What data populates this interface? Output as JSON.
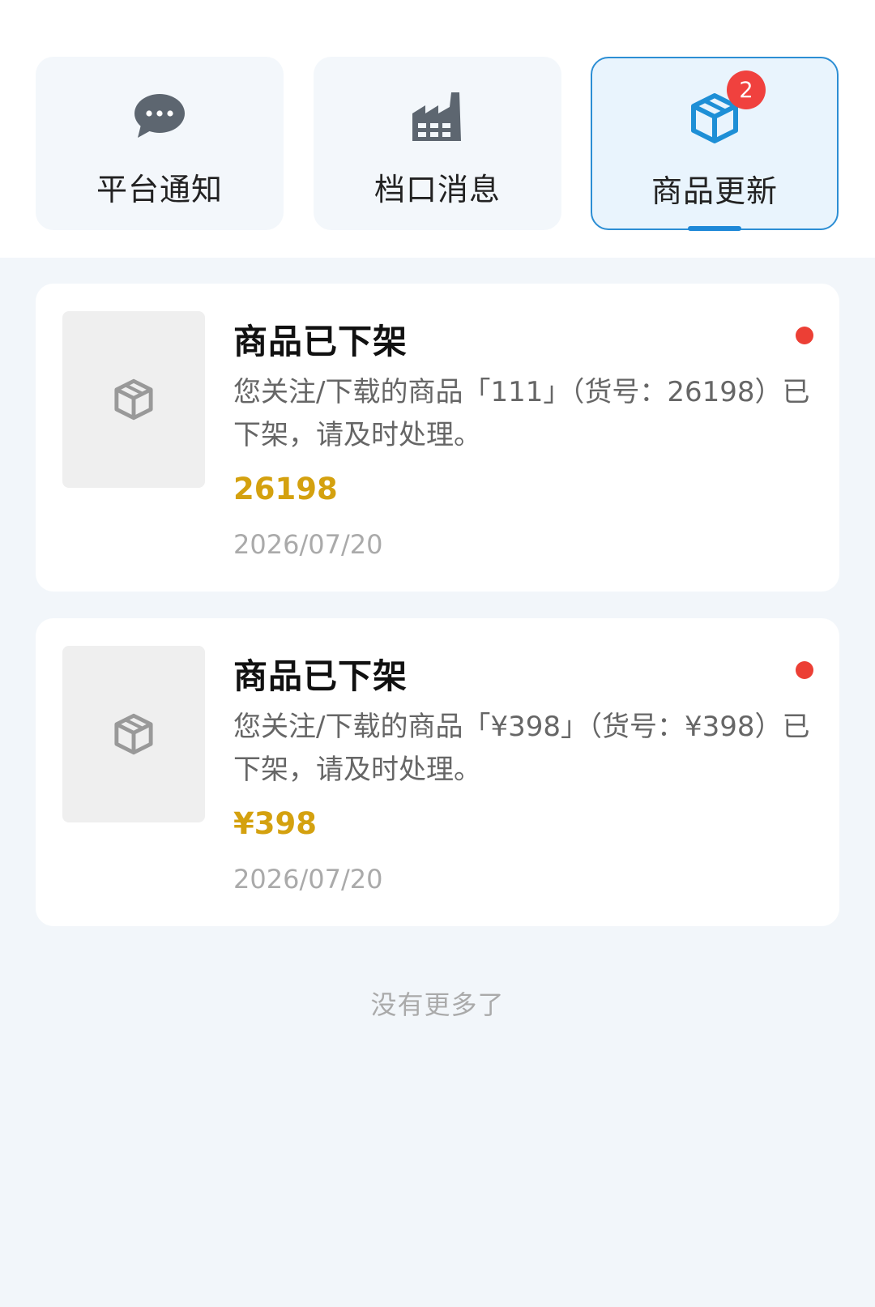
{
  "tabs": [
    {
      "label": "平台通知",
      "icon": "chat-bubble-icon"
    },
    {
      "label": "档口消息",
      "icon": "factory-icon"
    },
    {
      "label": "商品更新",
      "icon": "package-icon",
      "badge": "2",
      "active": true
    }
  ],
  "notifications": [
    {
      "title": "商品已下架",
      "description": "您关注/下载的商品「111」（货号：26198）已下架，请及时处理。",
      "code": "26198",
      "date": "2026/07/20",
      "unread": true,
      "thumb_icon": "package-icon"
    },
    {
      "title": "商品已下架",
      "description": "您关注/下载的商品「¥398」（货号：¥398）已下架，请及时处理。",
      "code": "¥398",
      "date": "2026/07/20",
      "unread": true,
      "thumb_icon": "package-icon"
    }
  ],
  "footer": {
    "end_text": "没有更多了"
  },
  "colors": {
    "accent": "#1e88d8",
    "badge": "#f0413e",
    "unread_dot": "#ec3f35",
    "code": "#d4a10f",
    "background": "#f2f6fa"
  }
}
